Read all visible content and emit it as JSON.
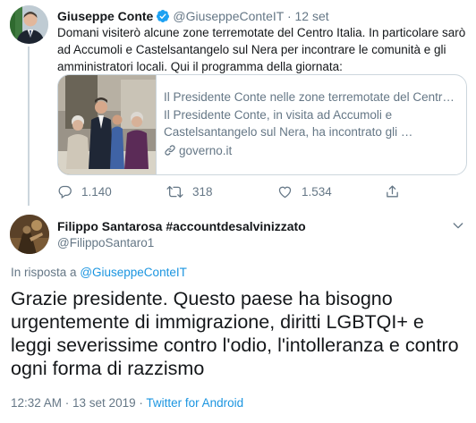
{
  "parent_tweet": {
    "name": "Giuseppe Conte",
    "handle": "@GiuseppeConteIT",
    "separator": "·",
    "time": "12 set",
    "text": "Domani visiterò alcune zone terremotate del Centro Italia. In particolare sarò ad Accumoli e Castelsantangelo sul Nera per incontrare le comunità e gli amministratori locali. Qui il programma della giornata:",
    "card": {
      "title": "Il Presidente Conte nelle zone terremotate del Centr…",
      "description": "Il Presidente Conte, in visita ad Accumoli e Castelsantangelo sul Nera, ha incontrato gli …",
      "domain": "governo.it"
    },
    "actions": {
      "replies": "1.140",
      "retweets": "318",
      "likes": "1.534"
    }
  },
  "reply_tweet": {
    "name": "Filippo Santarosa #accountdesalvinizzato",
    "handle": "@FilippoSantaro1",
    "reply_prefix": "In risposta a",
    "reply_to": "@GiuseppeConteIT",
    "text": "Grazie presidente. Questo paese ha bisogno urgentemente di immigrazione, diritti LGBTQI+ e leggi severissime contro l'odio, l'intolleranza e contro ogni forma di razzismo",
    "timestamp": "12:32 AM · 13 set 2019 ·",
    "source": "Twitter for Android"
  },
  "colors": {
    "text": "#14171a",
    "muted": "#657786",
    "link": "#1b95e0",
    "border": "#ccd6dd"
  }
}
